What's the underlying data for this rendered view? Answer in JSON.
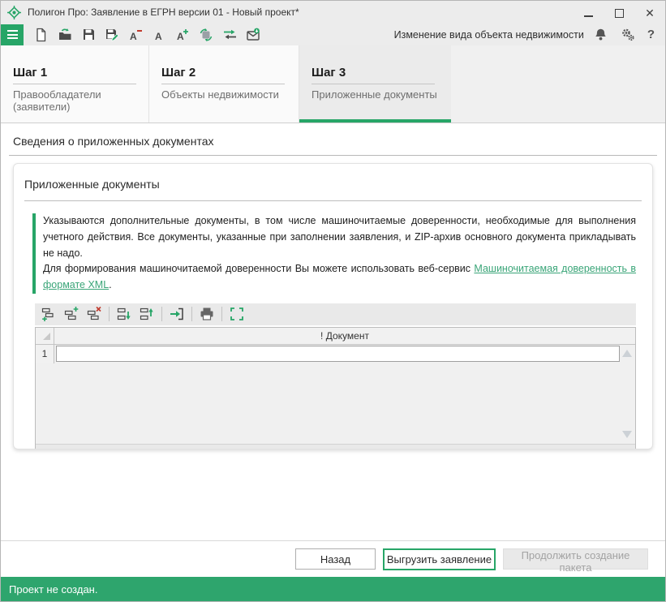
{
  "window": {
    "title": "Полигон Про: Заявление в ЕГРН версии 01 - Новый проект*",
    "close_glyph": "✕",
    "control_icons": [
      "minimize-icon",
      "maximize-icon",
      "close-icon"
    ]
  },
  "toolbar": {
    "left_icons": [
      "menu-icon",
      "new-document-icon",
      "open-folder-icon",
      "save-icon",
      "save-edit-icon",
      "font-decrease-icon",
      "font-reset-icon",
      "font-increase-icon",
      "convert-xml-icon",
      "transfer-icon",
      "send-mail-icon"
    ],
    "right_caption": "Изменение вида объекта недвижимости",
    "right_icons": [
      "bell-icon",
      "settings-gears-icon",
      "help-icon"
    ],
    "help_glyph": "?"
  },
  "tabs": [
    {
      "step": "Шаг 1",
      "label": "Правообладатели (заявители)",
      "active": false
    },
    {
      "step": "Шаг 2",
      "label": "Объекты недвижимости",
      "active": false
    },
    {
      "step": "Шаг 3",
      "label": "Приложенные документы",
      "active": true
    }
  ],
  "section": {
    "title": "Сведения о приложенных документах"
  },
  "card": {
    "title": "Приложенные документы",
    "info": {
      "paragraph1": "Указываются дополнительные документы, в том числе машиночитаемые доверенности, необходимые для выполнения учетного действия. Все документы, указанные при заполнении заявления, и ZIP-архив основного документа прикладывать не надо.",
      "paragraph2_prefix": "Для формирования машиночитаемой доверенности Вы можете использовать веб-сервис ",
      "link_text": "Машиночитаемая доверенность в формате XML",
      "paragraph2_suffix": "."
    },
    "grid_toolbar_icons": [
      "add-row-icon",
      "insert-row-icon",
      "delete-row-icon",
      "move-row-down-icon",
      "move-row-up-icon",
      "import-row-icon",
      "print-icon",
      "expand-table-icon"
    ],
    "table": {
      "column_header": "! Документ",
      "rows": [
        {
          "num": "1",
          "value": ""
        }
      ]
    }
  },
  "footer": {
    "back_label": "Назад",
    "upload_label": "Выгрузить заявление",
    "continue_label": "Продолжить создание пакета"
  },
  "statusbar": {
    "text": "Проект не создан."
  },
  "colors": {
    "accent": "#27a567",
    "status_bg": "#2ea56d",
    "link": "#3aa578",
    "active_tab_bg": "#ebebeb"
  }
}
